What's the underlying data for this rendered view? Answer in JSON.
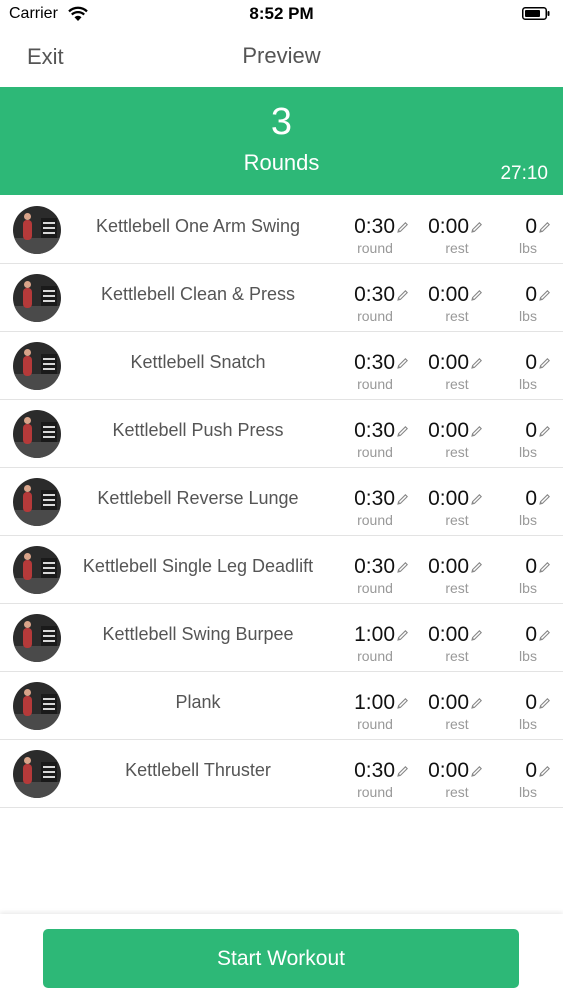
{
  "status_bar": {
    "carrier": "Carrier",
    "time": "8:52 PM"
  },
  "nav": {
    "exit_label": "Exit",
    "title": "Preview"
  },
  "header": {
    "rounds_count": "3",
    "rounds_label": "Rounds",
    "total_time": "27:10",
    "accent_color": "#2db877"
  },
  "exercises": [
    {
      "name": "Kettlebell One Arm Swing",
      "round": "0:30",
      "rest": "0:00",
      "lbs": "0",
      "round_unit": "round",
      "rest_unit": "rest",
      "lbs_unit": "lbs"
    },
    {
      "name": "Kettlebell Clean & Press",
      "round": "0:30",
      "rest": "0:00",
      "lbs": "0",
      "round_unit": "round",
      "rest_unit": "rest",
      "lbs_unit": "lbs"
    },
    {
      "name": "Kettlebell Snatch",
      "round": "0:30",
      "rest": "0:00",
      "lbs": "0",
      "round_unit": "round",
      "rest_unit": "rest",
      "lbs_unit": "lbs"
    },
    {
      "name": "Kettlebell Push Press",
      "round": "0:30",
      "rest": "0:00",
      "lbs": "0",
      "round_unit": "round",
      "rest_unit": "rest",
      "lbs_unit": "lbs"
    },
    {
      "name": "Kettlebell Reverse Lunge",
      "round": "0:30",
      "rest": "0:00",
      "lbs": "0",
      "round_unit": "round",
      "rest_unit": "rest",
      "lbs_unit": "lbs"
    },
    {
      "name": "Kettlebell Single Leg Deadlift",
      "round": "0:30",
      "rest": "0:00",
      "lbs": "0",
      "round_unit": "round",
      "rest_unit": "rest",
      "lbs_unit": "lbs"
    },
    {
      "name": "Kettlebell Swing Burpee",
      "round": "1:00",
      "rest": "0:00",
      "lbs": "0",
      "round_unit": "round",
      "rest_unit": "rest",
      "lbs_unit": "lbs"
    },
    {
      "name": "Plank",
      "round": "1:00",
      "rest": "0:00",
      "lbs": "0",
      "round_unit": "round",
      "rest_unit": "rest",
      "lbs_unit": "lbs"
    },
    {
      "name": "Kettlebell Thruster",
      "round": "0:30",
      "rest": "0:00",
      "lbs": "0",
      "round_unit": "round",
      "rest_unit": "rest",
      "lbs_unit": "lbs"
    }
  ],
  "footer": {
    "start_label": "Start Workout"
  }
}
